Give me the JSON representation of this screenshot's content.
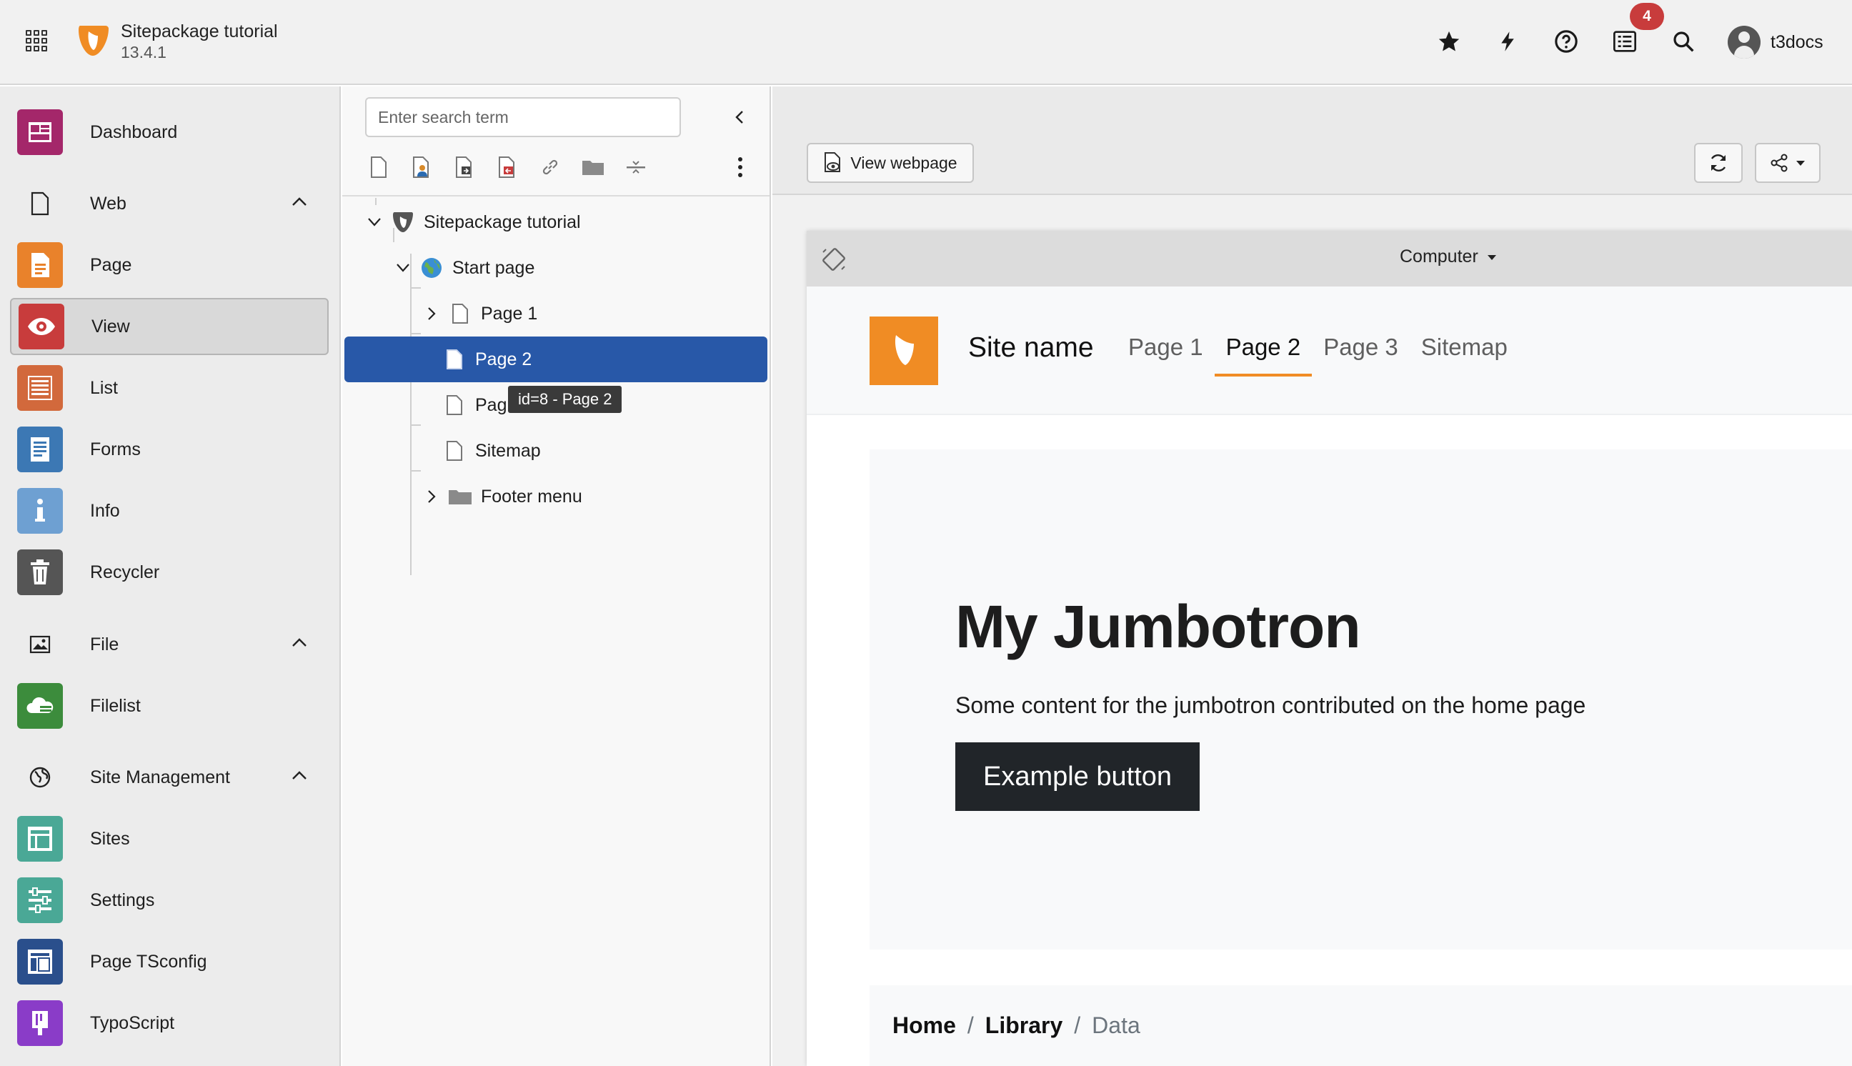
{
  "topbar": {
    "app_title": "Sitepackage tutorial",
    "version": "13.4.1",
    "notification_count": "4",
    "username": "t3docs",
    "icons": [
      "app-menu-icon",
      "typo3-logo-icon",
      "star-icon",
      "bolt-icon",
      "help-icon",
      "notifications-icon",
      "search-icon",
      "user-avatar-icon"
    ]
  },
  "sidebar": {
    "dashboard": "Dashboard",
    "web_group": "Web",
    "page": "Page",
    "view": "View",
    "list": "List",
    "forms": "Forms",
    "info": "Info",
    "recycler": "Recycler",
    "file_group": "File",
    "filelist": "Filelist",
    "site_group": "Site Management",
    "sites": "Sites",
    "settings": "Settings",
    "page_tsconfig": "Page TSconfig",
    "typoscript": "TypoScript",
    "colors": {
      "dashboard": "#a4276a",
      "page": "#e9822b",
      "view": "#c83c3c",
      "list": "#d2693c",
      "forms": "#3c78b4",
      "info": "#6ea0d2",
      "recycler": "#555555",
      "filelist": "#3c8c3c",
      "sites": "#4aa896",
      "settings": "#4aa896",
      "page_tsconfig": "#2a4f8c",
      "typoscript": "#8a3cc8"
    }
  },
  "tree": {
    "search_placeholder": "Enter search term",
    "nodes": {
      "root": "Sitepackage tutorial",
      "start": "Start page",
      "page1": "Page 1",
      "page2": "Page 2",
      "page3": "Pag",
      "sitemap": "Sitemap",
      "footer": "Footer menu"
    },
    "tooltip": "id=8 - Page 2",
    "selected_color": "#2858a8"
  },
  "content": {
    "view_webpage": "View webpage",
    "device": "Computer",
    "site": {
      "name": "Site name",
      "nav": [
        "Page 1",
        "Page 2",
        "Page 3",
        "Sitemap"
      ],
      "active_nav": "Page 2",
      "accent": "#f08c24",
      "jumbo_title": "My Jumbotron",
      "jumbo_text": "Some content for the jumbotron contributed on the home page",
      "jumbo_button": "Example button",
      "breadcrumb": {
        "home": "Home",
        "library": "Library",
        "data": "Data",
        "sep": "/"
      }
    }
  }
}
